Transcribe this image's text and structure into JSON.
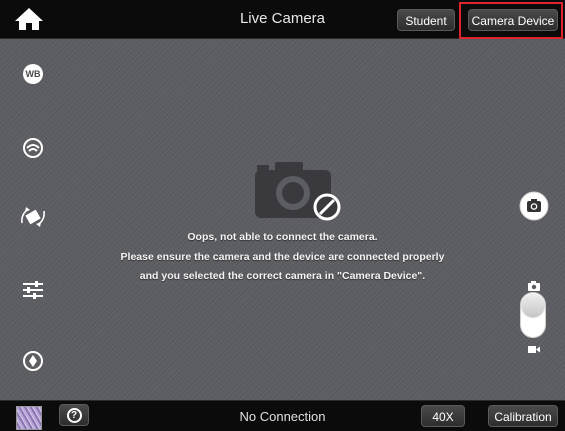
{
  "header": {
    "title": "Live Camera",
    "student_label": "Student",
    "camera_device_label": "Camera Device",
    "highlight_color": "#e0242e"
  },
  "sidebar": {
    "items": [
      {
        "name": "white-balance",
        "label": "WB",
        "icon": "wb-icon"
      },
      {
        "name": "exposure",
        "icon": "exposure-icon"
      },
      {
        "name": "rotate",
        "icon": "rotate-icon"
      },
      {
        "name": "adjustments",
        "icon": "sliders-icon"
      },
      {
        "name": "focus",
        "icon": "focus-icon"
      }
    ]
  },
  "main": {
    "camera_icon": "camera-disabled-icon",
    "message_lines": [
      "Oops, not able to connect the camera.",
      "Please ensure the camera and the device are connected properly",
      "and you selected the  correct camera in \"Camera Device\"."
    ]
  },
  "right_controls": {
    "snapshot_icon": "camera-snapshot-icon",
    "mode": "photo"
  },
  "footer": {
    "status": "No Connection",
    "help_symbol": "?",
    "zoom_label": "40X",
    "calibration_label": "Calibration"
  }
}
